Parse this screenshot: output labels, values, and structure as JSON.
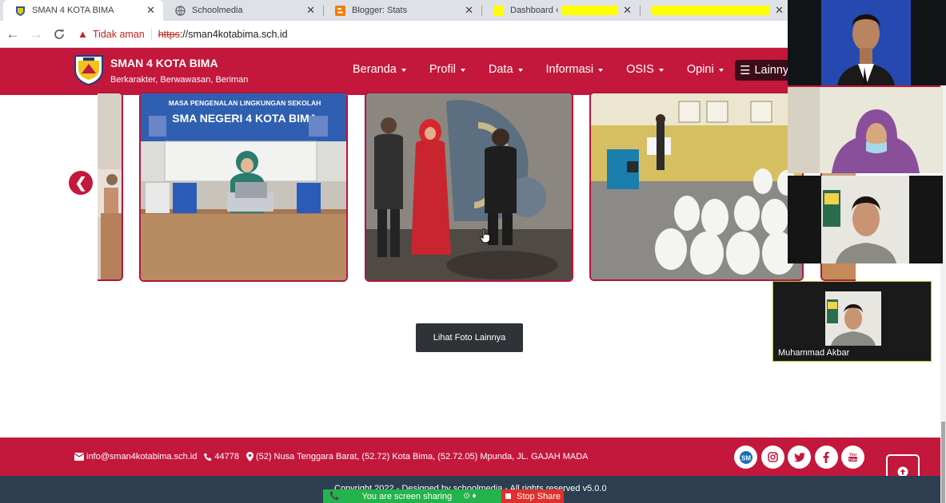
{
  "browser": {
    "tabs": [
      {
        "title": "SMAN 4 KOTA BIMA",
        "close": "✕"
      },
      {
        "title": "Schoolmedia",
        "close": "✕"
      },
      {
        "title": "Blogger: Stats",
        "close": "✕"
      },
      {
        "title": "Dashboard ‹",
        "close": "✕"
      },
      {
        "title": "",
        "close": "✕"
      }
    ],
    "security_label": "Tidak aman",
    "url_scheme": "https",
    "url_rest": "://sman4kotabima.sch.id"
  },
  "site": {
    "name": "SMAN 4 KOTA BIMA",
    "tagline": "Berkarakter, Berwawasan, Beriman",
    "nav": [
      "Beranda",
      "Profil",
      "Data",
      "Informasi",
      "OSIS",
      "Opini"
    ],
    "more_label": "Lainnya",
    "more_photos_label": "Lihat Foto Lainnya",
    "banner_line1": "MASA PENGENALAN LINGKUNGAN SEKOLAH",
    "banner_line2": "SMA NEGERI 4 KOTA BIMA"
  },
  "footer": {
    "email": "info@sman4kotabima.sch.id",
    "phone": "44778",
    "address": "(52) Nusa Tenggara Barat, (52.72) Kota Bima, (52.72.05) Mpunda, JL. GAJAH MADA",
    "copyright": "Copyright 2022 - Designed by schoolmedia - All rights reserved v5.0.0",
    "socials": [
      "sm-icon",
      "instagram-icon",
      "twitter-icon",
      "facebook-icon",
      "youtube-icon"
    ]
  },
  "screen_share": {
    "status": "You are screen sharing",
    "stop_label": "Stop Share"
  },
  "meeting": {
    "participant_name": "Muhammad Akbar"
  },
  "colors": {
    "brand": "#c4173c",
    "footer_dark": "#2c3e50",
    "share_green": "#23b44b",
    "share_red": "#e0302b"
  }
}
